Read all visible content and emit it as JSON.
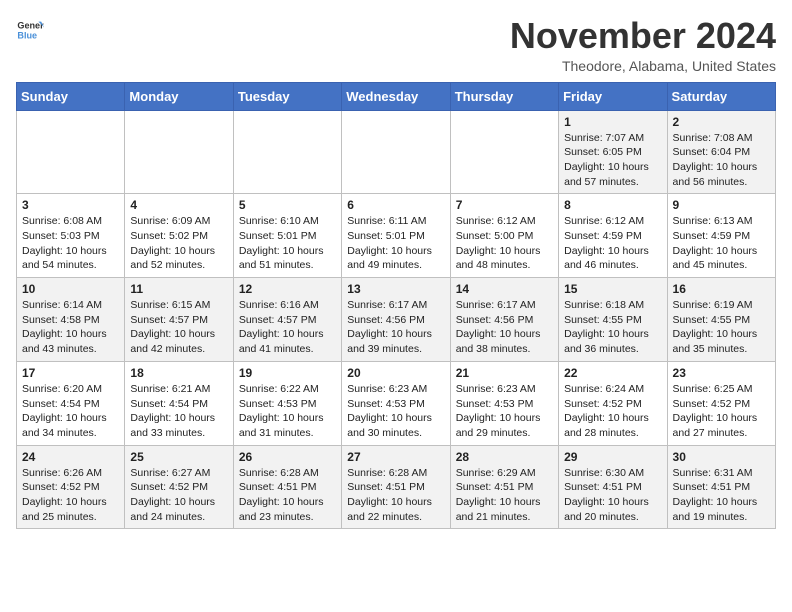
{
  "header": {
    "logo_line1": "General",
    "logo_line2": "Blue",
    "month": "November 2024",
    "location": "Theodore, Alabama, United States"
  },
  "weekdays": [
    "Sunday",
    "Monday",
    "Tuesday",
    "Wednesday",
    "Thursday",
    "Friday",
    "Saturday"
  ],
  "weeks": [
    [
      {
        "day": "",
        "info": ""
      },
      {
        "day": "",
        "info": ""
      },
      {
        "day": "",
        "info": ""
      },
      {
        "day": "",
        "info": ""
      },
      {
        "day": "",
        "info": ""
      },
      {
        "day": "1",
        "info": "Sunrise: 7:07 AM\nSunset: 6:05 PM\nDaylight: 10 hours and 57 minutes."
      },
      {
        "day": "2",
        "info": "Sunrise: 7:08 AM\nSunset: 6:04 PM\nDaylight: 10 hours and 56 minutes."
      }
    ],
    [
      {
        "day": "3",
        "info": "Sunrise: 6:08 AM\nSunset: 5:03 PM\nDaylight: 10 hours and 54 minutes."
      },
      {
        "day": "4",
        "info": "Sunrise: 6:09 AM\nSunset: 5:02 PM\nDaylight: 10 hours and 52 minutes."
      },
      {
        "day": "5",
        "info": "Sunrise: 6:10 AM\nSunset: 5:01 PM\nDaylight: 10 hours and 51 minutes."
      },
      {
        "day": "6",
        "info": "Sunrise: 6:11 AM\nSunset: 5:01 PM\nDaylight: 10 hours and 49 minutes."
      },
      {
        "day": "7",
        "info": "Sunrise: 6:12 AM\nSunset: 5:00 PM\nDaylight: 10 hours and 48 minutes."
      },
      {
        "day": "8",
        "info": "Sunrise: 6:12 AM\nSunset: 4:59 PM\nDaylight: 10 hours and 46 minutes."
      },
      {
        "day": "9",
        "info": "Sunrise: 6:13 AM\nSunset: 4:59 PM\nDaylight: 10 hours and 45 minutes."
      }
    ],
    [
      {
        "day": "10",
        "info": "Sunrise: 6:14 AM\nSunset: 4:58 PM\nDaylight: 10 hours and 43 minutes."
      },
      {
        "day": "11",
        "info": "Sunrise: 6:15 AM\nSunset: 4:57 PM\nDaylight: 10 hours and 42 minutes."
      },
      {
        "day": "12",
        "info": "Sunrise: 6:16 AM\nSunset: 4:57 PM\nDaylight: 10 hours and 41 minutes."
      },
      {
        "day": "13",
        "info": "Sunrise: 6:17 AM\nSunset: 4:56 PM\nDaylight: 10 hours and 39 minutes."
      },
      {
        "day": "14",
        "info": "Sunrise: 6:17 AM\nSunset: 4:56 PM\nDaylight: 10 hours and 38 minutes."
      },
      {
        "day": "15",
        "info": "Sunrise: 6:18 AM\nSunset: 4:55 PM\nDaylight: 10 hours and 36 minutes."
      },
      {
        "day": "16",
        "info": "Sunrise: 6:19 AM\nSunset: 4:55 PM\nDaylight: 10 hours and 35 minutes."
      }
    ],
    [
      {
        "day": "17",
        "info": "Sunrise: 6:20 AM\nSunset: 4:54 PM\nDaylight: 10 hours and 34 minutes."
      },
      {
        "day": "18",
        "info": "Sunrise: 6:21 AM\nSunset: 4:54 PM\nDaylight: 10 hours and 33 minutes."
      },
      {
        "day": "19",
        "info": "Sunrise: 6:22 AM\nSunset: 4:53 PM\nDaylight: 10 hours and 31 minutes."
      },
      {
        "day": "20",
        "info": "Sunrise: 6:23 AM\nSunset: 4:53 PM\nDaylight: 10 hours and 30 minutes."
      },
      {
        "day": "21",
        "info": "Sunrise: 6:23 AM\nSunset: 4:53 PM\nDaylight: 10 hours and 29 minutes."
      },
      {
        "day": "22",
        "info": "Sunrise: 6:24 AM\nSunset: 4:52 PM\nDaylight: 10 hours and 28 minutes."
      },
      {
        "day": "23",
        "info": "Sunrise: 6:25 AM\nSunset: 4:52 PM\nDaylight: 10 hours and 27 minutes."
      }
    ],
    [
      {
        "day": "24",
        "info": "Sunrise: 6:26 AM\nSunset: 4:52 PM\nDaylight: 10 hours and 25 minutes."
      },
      {
        "day": "25",
        "info": "Sunrise: 6:27 AM\nSunset: 4:52 PM\nDaylight: 10 hours and 24 minutes."
      },
      {
        "day": "26",
        "info": "Sunrise: 6:28 AM\nSunset: 4:51 PM\nDaylight: 10 hours and 23 minutes."
      },
      {
        "day": "27",
        "info": "Sunrise: 6:28 AM\nSunset: 4:51 PM\nDaylight: 10 hours and 22 minutes."
      },
      {
        "day": "28",
        "info": "Sunrise: 6:29 AM\nSunset: 4:51 PM\nDaylight: 10 hours and 21 minutes."
      },
      {
        "day": "29",
        "info": "Sunrise: 6:30 AM\nSunset: 4:51 PM\nDaylight: 10 hours and 20 minutes."
      },
      {
        "day": "30",
        "info": "Sunrise: 6:31 AM\nSunset: 4:51 PM\nDaylight: 10 hours and 19 minutes."
      }
    ]
  ]
}
